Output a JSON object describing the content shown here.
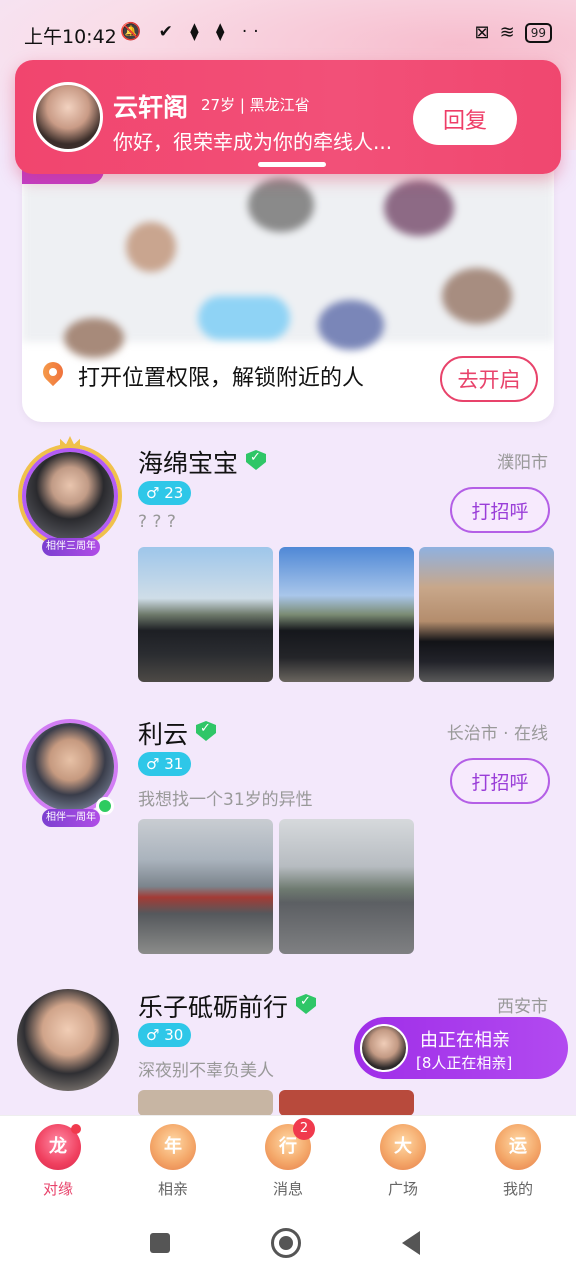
{
  "status_bar": {
    "time": "上午10:42",
    "left_icons": "🔕 ✔ ⧫ ⧫ ··",
    "battery": "99"
  },
  "notification": {
    "name": "云轩阁",
    "meta": "27岁 | 黑龙江省",
    "message": "你好，很荣幸成为你的牵线人...",
    "reply_label": "回复"
  },
  "location_card": {
    "text": "打开位置权限，解锁附近的人",
    "button_label": "去开启"
  },
  "users": [
    {
      "name": "海绵宝宝",
      "city": "濮阳市",
      "age": "♂ 23",
      "bio": "? ? ?",
      "greet_label": "打招呼",
      "badge": "相伴三周年"
    },
    {
      "name": "利云",
      "city": "长治市 · 在线",
      "age": "♂ 31",
      "bio": "我想找一个31岁的异性",
      "greet_label": "打招呼",
      "badge": "相伴一周年"
    },
    {
      "name": "乐子砥砺前行",
      "city": "西安市",
      "age": "♂ 30",
      "bio": "深夜别不辜负美人"
    }
  ],
  "live_pill": {
    "title": "由正在相亲",
    "subtitle": "[8人正在相亲]"
  },
  "bottom_nav": {
    "items": [
      {
        "icon_char": "龙",
        "label": "对缘"
      },
      {
        "icon_char": "年",
        "label": "相亲"
      },
      {
        "icon_char": "行",
        "label": "消息",
        "badge": "2"
      },
      {
        "icon_char": "大",
        "label": "广场"
      },
      {
        "icon_char": "运",
        "label": "我的"
      }
    ]
  },
  "colors": {
    "accent": "#e8436b",
    "purple": "#9a3ed8",
    "notification_bg": "#f1456e"
  }
}
